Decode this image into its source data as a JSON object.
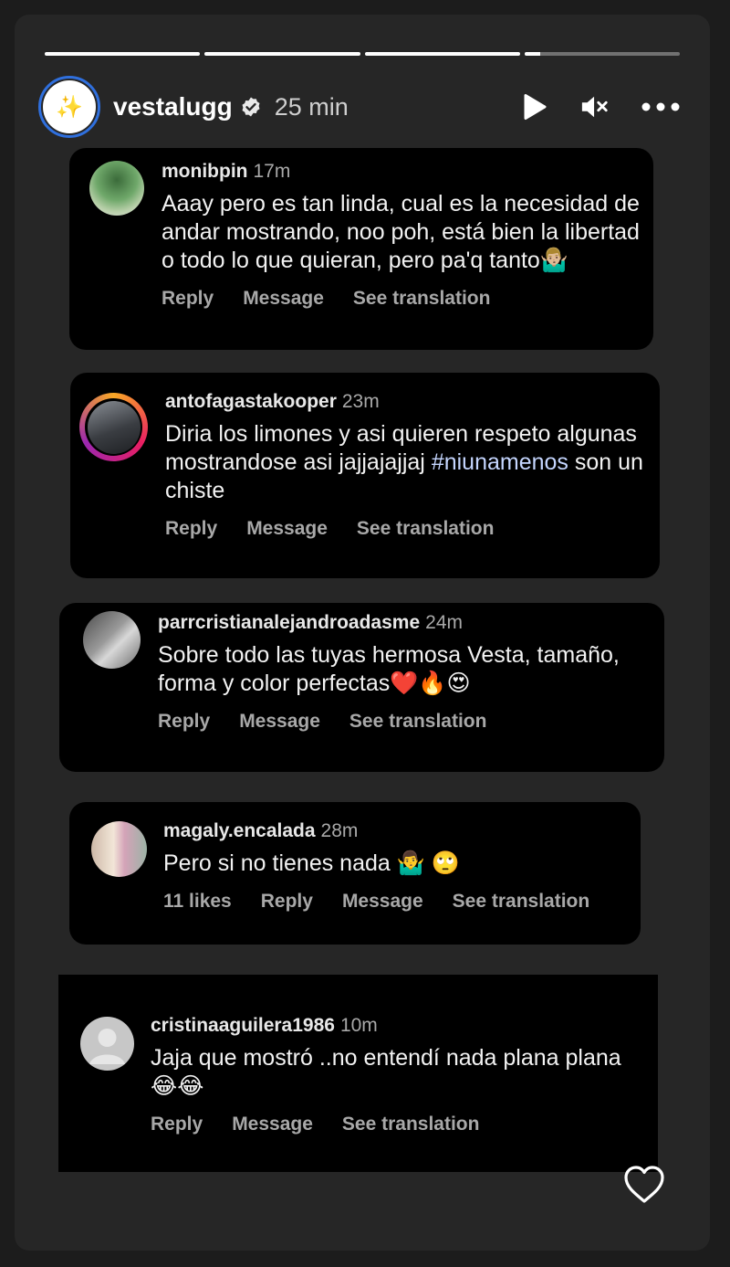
{
  "story": {
    "progress": [
      1,
      1,
      1,
      0.1
    ],
    "username": "vestalugg",
    "time": "25 min",
    "avatar_glyph": "✨"
  },
  "comments": [
    {
      "user": "monibpin",
      "ago": "17m",
      "text": "Aaay pero es tan linda, cual es la necesidad de andar mostrando, noo poh, está bien la libertad o todo lo que quieran, pero pa'q tanto🤷🏼‍♂️",
      "actions": [
        "Reply",
        "Message",
        "See translation"
      ]
    },
    {
      "user": "antofagastakooper",
      "ago": "23m",
      "text_before": "Diria los limones y asi quieren respeto algunas mostrandose asi jajjajajjaj ",
      "hashtag": "#niunamenos",
      "text_after": " son un chiste",
      "actions": [
        "Reply",
        "Message",
        "See translation"
      ]
    },
    {
      "user": "parrcristianalejandroadasme",
      "ago": "24m",
      "text": "Sobre todo las tuyas hermosa Vesta, tamaño, forma y color perfectas❤️🔥😍",
      "actions": [
        "Reply",
        "Message",
        "See translation"
      ]
    },
    {
      "user": "magaly.encalada",
      "ago": "28m",
      "text": "Pero si no tienes nada 🤷‍♂️ 🙄",
      "actions": [
        "11 likes",
        "Reply",
        "Message",
        "See translation"
      ]
    },
    {
      "user": "cristinaaguilera1986",
      "ago": "10m",
      "text": "Jaja que mostró ..no entendí nada plana plana 😂😂",
      "actions": [
        "Reply",
        "Message",
        "See translation"
      ]
    }
  ],
  "icons": {
    "verified": "verified-badge-icon",
    "play": "play-icon",
    "mute": "mute-icon",
    "more": "more-icon",
    "like": "heart-icon"
  }
}
